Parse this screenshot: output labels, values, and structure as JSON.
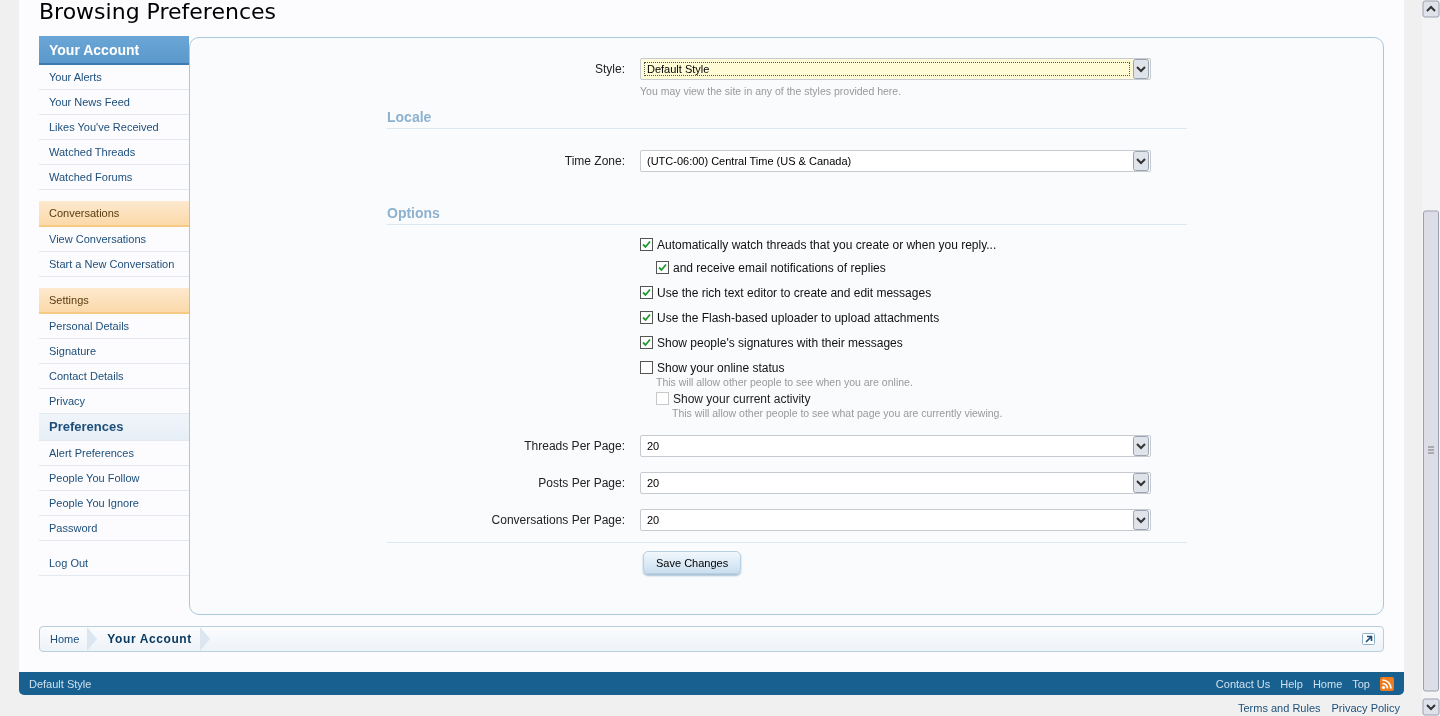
{
  "page_title": "Browsing Preferences",
  "sidebar": {
    "items": [
      {
        "kind": "title",
        "label": "Your Account"
      },
      {
        "kind": "link",
        "label": "Your Alerts"
      },
      {
        "kind": "link",
        "label": "Your News Feed"
      },
      {
        "kind": "link",
        "label": "Likes You've Received"
      },
      {
        "kind": "link",
        "label": "Watched Threads"
      },
      {
        "kind": "link",
        "label": "Watched Forums"
      },
      {
        "kind": "section",
        "label": "Conversations"
      },
      {
        "kind": "link",
        "label": "View Conversations"
      },
      {
        "kind": "link",
        "label": "Start a New Conversation"
      },
      {
        "kind": "section",
        "label": "Settings"
      },
      {
        "kind": "link",
        "label": "Personal Details"
      },
      {
        "kind": "link",
        "label": "Signature"
      },
      {
        "kind": "link",
        "label": "Contact Details"
      },
      {
        "kind": "link",
        "label": "Privacy"
      },
      {
        "kind": "current",
        "label": "Preferences"
      },
      {
        "kind": "link",
        "label": "Alert Preferences"
      },
      {
        "kind": "link",
        "label": "People You Follow"
      },
      {
        "kind": "link",
        "label": "People You Ignore"
      },
      {
        "kind": "link",
        "label": "Password"
      },
      {
        "kind": "logout",
        "label": "Log Out"
      }
    ]
  },
  "style_field": {
    "label": "Style:",
    "value": "Default Style",
    "focused": true,
    "hint": "You may view the site in any of the styles provided here."
  },
  "locale": {
    "heading": "Locale",
    "time_zone": {
      "label": "Time Zone:",
      "value": "(UTC-06:00) Central Time (US & Canada)",
      "focused": false
    }
  },
  "options": {
    "heading": "Options",
    "checkboxes": [
      {
        "label": "Automatically watch threads that you create or when you reply...",
        "checked": true,
        "disabled": false,
        "children": [
          {
            "label": "and receive email notifications of replies",
            "checked": true,
            "disabled": false
          }
        ]
      },
      {
        "label": "Use the rich text editor to create and edit messages",
        "checked": true,
        "disabled": false
      },
      {
        "label": "Use the Flash-based uploader to upload attachments",
        "checked": true,
        "disabled": false
      },
      {
        "label": "Show people's signatures with their messages",
        "checked": true,
        "disabled": false
      },
      {
        "label": "Show your online status",
        "checked": false,
        "disabled": false,
        "hint": "This will allow other people to see when you are online.",
        "children": [
          {
            "label": "Show your current activity",
            "checked": false,
            "disabled": true,
            "hint": "This will allow other people to see what page you are currently viewing."
          }
        ]
      }
    ],
    "selects": [
      {
        "label": "Threads Per Page:",
        "value": "20",
        "focused": false
      },
      {
        "label": "Posts Per Page:",
        "value": "20",
        "focused": false
      },
      {
        "label": "Conversations Per Page:",
        "value": "20",
        "focused": false
      }
    ]
  },
  "save_button": "Save Changes",
  "breadcrumb": [
    {
      "label": "Home",
      "current": false
    },
    {
      "label": "Your Account",
      "current": true
    }
  ],
  "footer": {
    "style_link": "Default Style",
    "links": [
      "Contact Us",
      "Help",
      "Home",
      "Top"
    ]
  },
  "bottom_links": [
    "Terms and Rules",
    "Privacy Policy"
  ]
}
